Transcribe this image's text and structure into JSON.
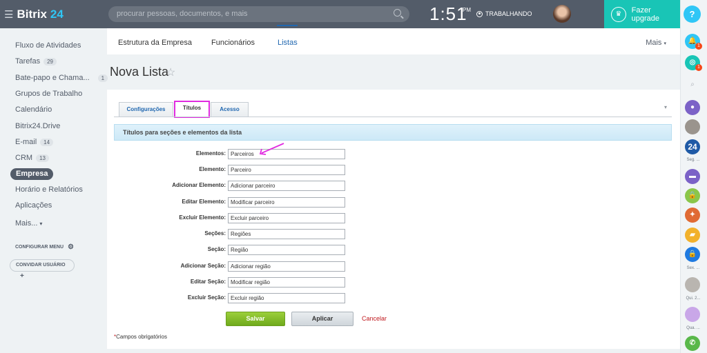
{
  "topbar": {
    "logo_text": "Bitrix",
    "logo_num": "24",
    "search_placeholder": "procurar pessoas, documentos, e mais",
    "time": "1:51",
    "ampm": "PM",
    "status": "TRABALHANDO",
    "upgrade_label": "Fazer upgrade"
  },
  "right_panel": {
    "help": "?",
    "badge_1": "1",
    "badge_2": "1",
    "item_24": "24",
    "label_seg": "Seg. ...",
    "label_sex": "Sex. ...",
    "label_qui": "Qui. 2...",
    "label_qua": "Qua. ..."
  },
  "sidebar": {
    "items": [
      {
        "label": "Fluxo de Atividades",
        "counter": ""
      },
      {
        "label": "Tarefas",
        "counter": "29"
      },
      {
        "label": "Bate-papo e Chama...",
        "counter": "1"
      },
      {
        "label": "Grupos de Trabalho",
        "counter": ""
      },
      {
        "label": "Calendário",
        "counter": ""
      },
      {
        "label": "Bitrix24.Drive",
        "counter": ""
      },
      {
        "label": "E-mail",
        "counter": "14"
      },
      {
        "label": "CRM",
        "counter": "13"
      },
      {
        "label": "Empresa",
        "counter": ""
      },
      {
        "label": "Horário e Relatórios",
        "counter": ""
      },
      {
        "label": "Aplicações",
        "counter": ""
      },
      {
        "label": "Mais...",
        "counter": ""
      }
    ],
    "config_menu": "CONFIGURAR MENU",
    "invite_user": "CONVIDAR USUÁRIO"
  },
  "main_tabs": {
    "tab1": "Estrutura da Empresa",
    "tab2": "Funcionários",
    "tab3": "Listas",
    "more": "Mais"
  },
  "page": {
    "title": "Nova Lista"
  },
  "form_tabs": {
    "config": "Configurações",
    "titles": "Títulos",
    "access": "Acesso"
  },
  "section_title": "Títulos para seções e elementos da lista",
  "fields": [
    {
      "label": "Elementos:",
      "value": "Parceiros"
    },
    {
      "label": "Elemento:",
      "value": "Parceiro"
    },
    {
      "label": "Adicionar Elemento:",
      "value": "Adicionar parceiro"
    },
    {
      "label": "Editar Elemento:",
      "value": "Modificar parceiro"
    },
    {
      "label": "Excluir Elemento:",
      "value": "Excluir parceiro"
    },
    {
      "label": "Seções:",
      "value": "Regiões"
    },
    {
      "label": "Seção:",
      "value": "Região"
    },
    {
      "label": "Adicionar Seção:",
      "value": "Adicionar região"
    },
    {
      "label": "Editar Seção:",
      "value": "Modificar região"
    },
    {
      "label": "Excluir Seção:",
      "value": "Excluir região"
    }
  ],
  "buttons": {
    "save": "Salvar",
    "apply": "Aplicar",
    "cancel": "Cancelar"
  },
  "required_note": "Campos obrigatórios",
  "colors": {
    "topbar": "#535c69",
    "accent": "#2fc6f6",
    "upgrade": "#19c5b6",
    "highlight": "#e02be0",
    "save": "#7ab526"
  }
}
